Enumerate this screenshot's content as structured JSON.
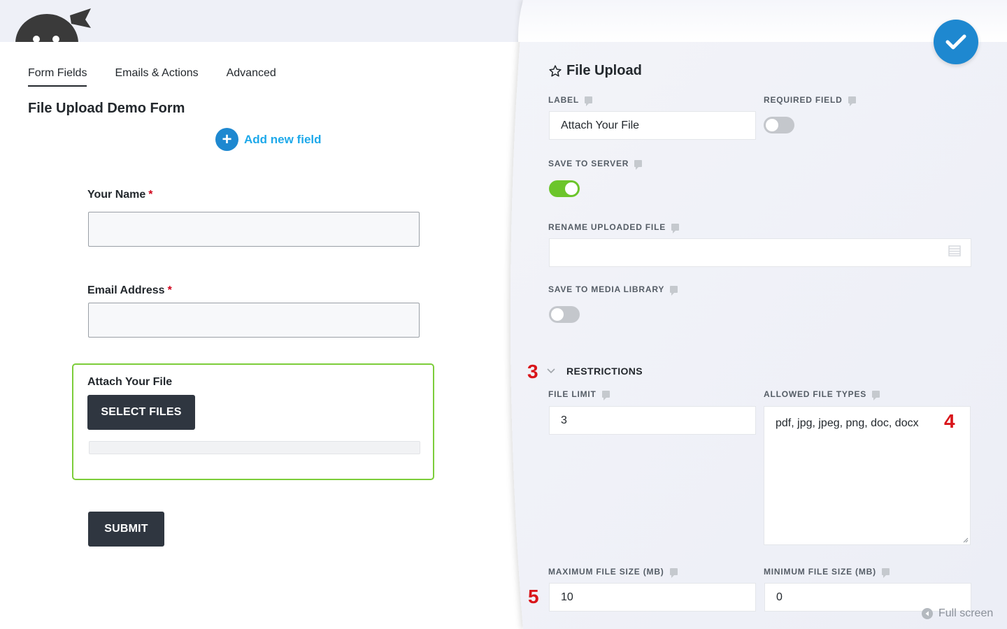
{
  "tabs": [
    "Form Fields",
    "Emails & Actions",
    "Advanced"
  ],
  "form": {
    "title": "File Upload Demo Form",
    "add_field": "Add new field",
    "name_label": "Your Name",
    "email_label": "Email Address",
    "required_mark": "*",
    "file_label": "Attach Your File",
    "select_files": "SELECT FILES",
    "submit": "SUBMIT"
  },
  "panel": {
    "title": "File Upload",
    "label_label": "LABEL",
    "label_value": "Attach Your File",
    "required_label": "REQUIRED FIELD",
    "required_on": false,
    "save_server_label": "SAVE TO SERVER",
    "save_server_on": true,
    "rename_label": "RENAME UPLOADED FILE",
    "rename_value": "",
    "media_label": "SAVE TO MEDIA LIBRARY",
    "media_on": false,
    "restrictions": "RESTRICTIONS",
    "file_limit_label": "FILE LIMIT",
    "file_limit_value": "3",
    "allowed_label": "ALLOWED FILE TYPES",
    "allowed_value": "pdf, jpg, jpeg, png, doc, docx",
    "max_size_label": "MAXIMUM FILE SIZE (MB)",
    "max_size_value": "10",
    "min_size_label": "MINIMUM FILE SIZE (MB)",
    "min_size_value": "0",
    "fullscreen": "Full screen"
  },
  "annotations": {
    "a3": "3",
    "a4": "4",
    "a5": "5"
  },
  "colors": {
    "accent": "#1e88d0",
    "toggle_on": "#6cc52b",
    "annotation": "#d9151a",
    "field_border": "#7ccd3a"
  }
}
